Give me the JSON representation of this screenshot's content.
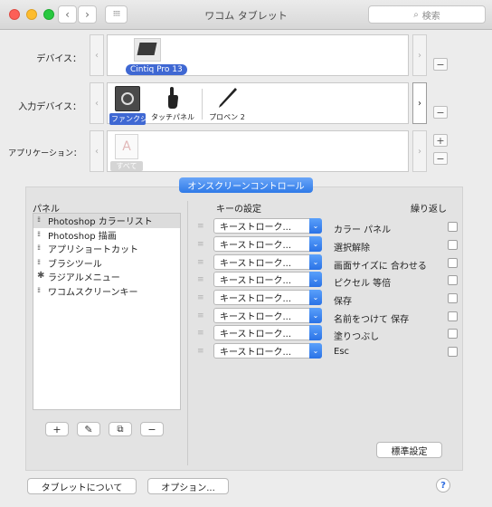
{
  "window": {
    "title": "ワコム タブレット",
    "search_placeholder": "検索"
  },
  "devices": {
    "label": "デバイス：",
    "items": [
      {
        "label": "Cintiq Pro 13",
        "selected": true
      }
    ]
  },
  "input_devices": {
    "label": "入力デバイス：",
    "items": [
      {
        "label": "ファンクション",
        "selected": true,
        "icon": "function-icon"
      },
      {
        "label": "タッチパネル",
        "selected": false,
        "icon": "touch-hand-icon"
      },
      {
        "label": "プロペン 2",
        "selected": false,
        "icon": "pen-icon"
      }
    ]
  },
  "applications": {
    "label": "アプリケーション：",
    "items": [
      {
        "label": "すべて",
        "selected": false,
        "icon": "all-apps-icon"
      }
    ]
  },
  "tab": {
    "label": "オンスクリーンコントロール"
  },
  "panel": {
    "header": "パネル",
    "items": [
      {
        "label": "Photoshop カラーリスト",
        "selected": true,
        "icon": "grid-icon"
      },
      {
        "label": "Photoshop 描画",
        "selected": false,
        "icon": "grid-icon"
      },
      {
        "label": "アプリショートカット",
        "selected": false,
        "icon": "grid-icon"
      },
      {
        "label": "ブラシツール",
        "selected": false,
        "icon": "grid-icon"
      },
      {
        "label": "ラジアルメニュー",
        "selected": false,
        "icon": "radial-icon"
      },
      {
        "label": "ワコムスクリーンキー",
        "selected": false,
        "icon": "grid-icon"
      }
    ],
    "buttons": {
      "add": "+",
      "remove": "−"
    }
  },
  "keys": {
    "header": "キーの設定",
    "repeat_header": "繰り返し",
    "rows": [
      {
        "key": "キーストローク...",
        "action": "カラー パネル",
        "repeat": false
      },
      {
        "key": "キーストローク...",
        "action": "選択解除",
        "repeat": false
      },
      {
        "key": "キーストローク...",
        "action": "画面サイズに 合わせる",
        "repeat": false
      },
      {
        "key": "キーストローク...",
        "action": "ピクセル 等倍",
        "repeat": false
      },
      {
        "key": "キーストローク...",
        "action": "保存",
        "repeat": false
      },
      {
        "key": "キーストローク...",
        "action": "名前をつけて 保存",
        "repeat": false
      },
      {
        "key": "キーストローク...",
        "action": "塗りつぶし",
        "repeat": false
      },
      {
        "key": "キーストローク...",
        "action": "Esc",
        "repeat": false
      }
    ]
  },
  "buttons": {
    "default": "標準設定",
    "about": "タブレットについて",
    "options": "オプション...",
    "help": "?"
  },
  "colors": {
    "accent": "#2f7ae8",
    "chip": "#3f68d3"
  }
}
